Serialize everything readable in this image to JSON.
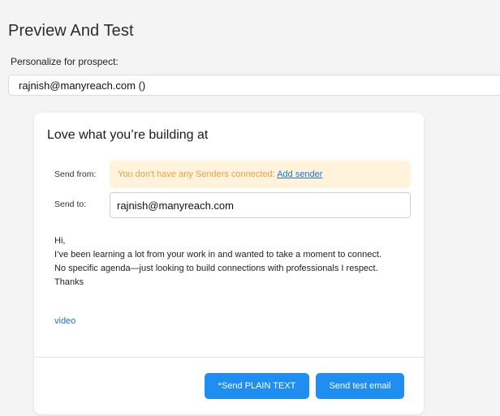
{
  "page": {
    "title": "Preview And Test",
    "personalize_label": "Personalize for prospect:",
    "prospect_value": "rajnish@manyreach.com ()"
  },
  "preview": {
    "subject": "Love what you’re building at",
    "send_from_label": "Send from:",
    "no_senders_text": "You don't have any Senders connected: ",
    "add_sender_link": "Add sender",
    "send_to_label": "Send to:",
    "send_to_value": "rajnish@manyreach.com",
    "body_lines": [
      "Hi,",
      "I’ve been learning a lot from your work in and wanted to take a moment to connect.",
      "No specific agenda—just looking to build connections with professionals I respect.",
      "Thanks"
    ],
    "video_link": "video"
  },
  "actions": {
    "send_plain_text": "*Send PLAIN TEXT",
    "send_test_email": "Send test email"
  },
  "colors": {
    "page_background": "#f4f4f5",
    "primary_button": "#1e8ef0",
    "warning_background": "#fff3dc",
    "warning_text": "#f0a043",
    "link": "#1a73d9"
  }
}
